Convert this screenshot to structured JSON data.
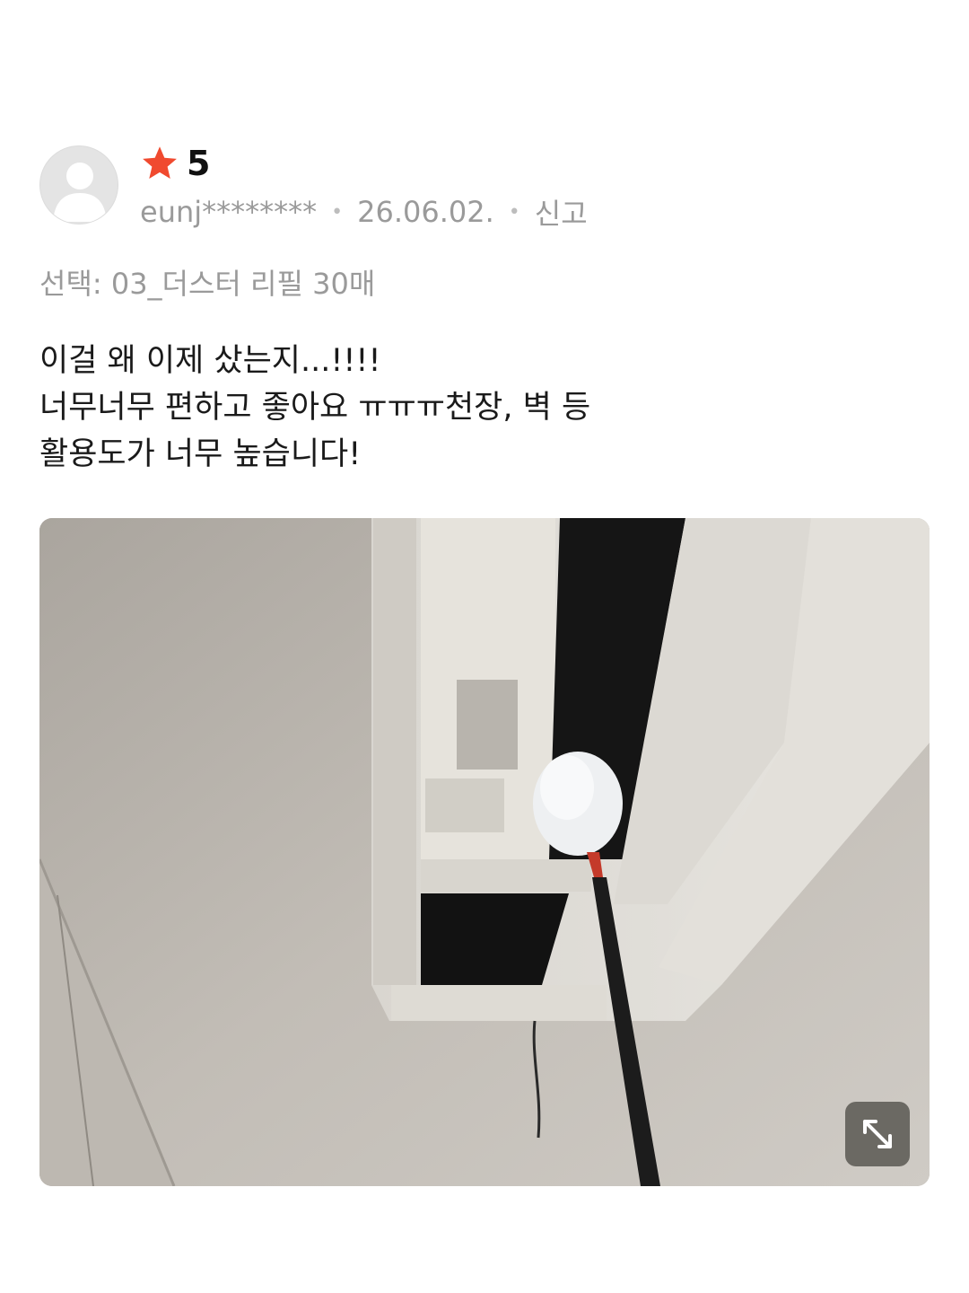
{
  "review": {
    "rating": "5",
    "author": "eunj********",
    "date": "26.06.02.",
    "report_label": "신고",
    "option": "선택: 03_더스터 리필 30매",
    "body_lines": [
      "이걸 왜 이제 샀는지...!!!!",
      "너무너무 편하고 좋아요 ㅠㅠㅠ천장, 벽 등",
      "활용도가 너무 높습니다!"
    ]
  },
  "icons": {
    "avatar": "person-silhouette-icon",
    "rating": "star-icon",
    "expand": "expand-arrows-icon"
  },
  "colors": {
    "star": "#f04a2f",
    "meta_text": "#9a9a9a",
    "body_text": "#1a1a1a"
  }
}
